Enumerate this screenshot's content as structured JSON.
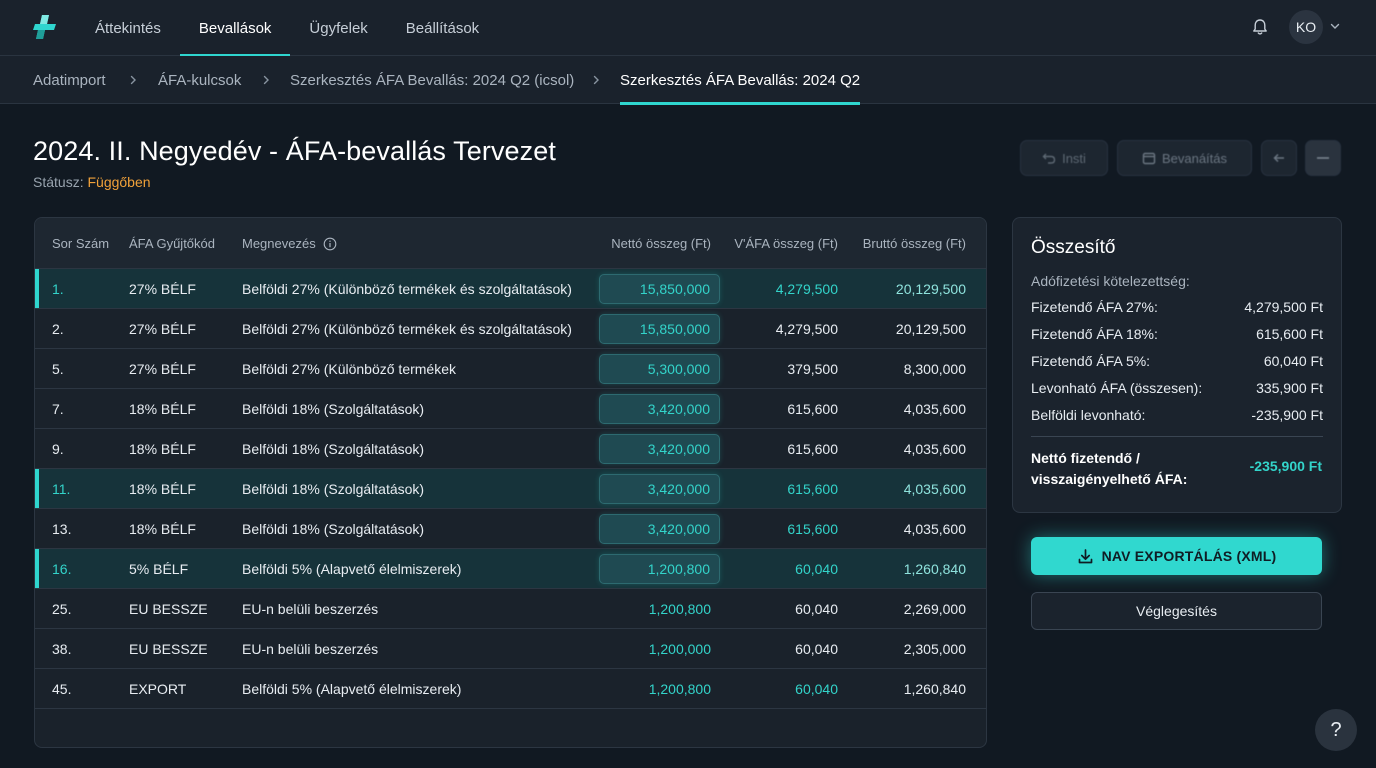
{
  "nav": {
    "items": [
      {
        "label": "Áttekintés"
      },
      {
        "label": "Bevallások"
      },
      {
        "label": "Ügyfelek"
      },
      {
        "label": "Beállítások"
      }
    ],
    "active": "Bevallások",
    "avatar_initials": "KO"
  },
  "breadcrumb": [
    {
      "label": "Adatimport"
    },
    {
      "label": "ÁFA-kulcsok"
    },
    {
      "label": "Szerkesztés ÁFA Bevallás: 2024 Q2 (icsol)"
    },
    {
      "label": "Szerkesztés ÁFA Bevallás: 2024 Q2"
    }
  ],
  "page": {
    "title": "2024. II. Negyedév - ÁFA-bevallás Tervezet",
    "status_label": "Státusz:",
    "status_value": "Függőben",
    "status_color": "#f0a13a"
  },
  "toolbar": {
    "undo_label": "Insti",
    "revert_label": "Bevanáítás"
  },
  "table": {
    "headers": {
      "row": "Sor Szám",
      "code": "ÁFA Gyűjtőkód",
      "name": "Megnevezés",
      "net": "Nettó összeg (Ft)",
      "vat": "V'ÁFA összeg (Ft)",
      "gross": "Bruttó összeg (Ft)"
    },
    "rows": [
      {
        "row": "1.",
        "code": "27% BÉLF",
        "name": "Belföldi 27% (Különböző termékek és szolgáltatások)",
        "net": "15,850,000",
        "vat": "4,279,500",
        "gross": "20,129,500"
      },
      {
        "row": "2.",
        "code": "27% BÉLF",
        "name": "Belföldi 27% (Különböző termékek és szolgáltatások)",
        "net": "15,850,000",
        "vat": "4,279,500",
        "gross": "20,129,500"
      },
      {
        "row": "5.",
        "code": "27% BÉLF",
        "name": "Belföldi 27% (Különböző termékek",
        "net": "5,300,000",
        "vat": "379,500",
        "gross": "8,300,000"
      },
      {
        "row": "7.",
        "code": "18% BÉLF",
        "name": "Belföldi 18% (Szolgáltatások)",
        "net": "3,420,000",
        "vat": "615,600",
        "gross": "4,035,600"
      },
      {
        "row": "9.",
        "code": "18% BÉLF",
        "name": "Belföldi 18% (Szolgáltatások)",
        "net": "3,420,000",
        "vat": "615,600",
        "gross": "4,035,600"
      },
      {
        "row": "11.",
        "code": "18% BÉLF",
        "name": "Belföldi 18% (Szolgáltatások)",
        "net": "3,420,000",
        "vat": "615,600",
        "gross": "4,035,600"
      },
      {
        "row": "13.",
        "code": "18% BÉLF",
        "name": "Belföldi 18% (Szolgáltatások)",
        "net": "3,420,000",
        "vat": "615,600",
        "gross": "4,035,600"
      },
      {
        "row": "16.",
        "code": "5% BÉLF",
        "name": "Belföldi 5% (Alapvető élelmiszerek)",
        "net": "1,200,800",
        "vat": "60,040",
        "gross": "1,260,840"
      },
      {
        "row": "25.",
        "code": "EU BESSZE",
        "name": "EU-n belüli beszerzés",
        "net": "1,200,800",
        "vat": "60,040",
        "gross": "2,269,000"
      },
      {
        "row": "38.",
        "code": "EU BESSZE",
        "name": "EU-n belüli beszerzés",
        "net": "1,200,000",
        "vat": "60,040",
        "gross": "2,305,000"
      },
      {
        "row": "45.",
        "code": "EXPORT",
        "name": "Belföldi 5% (Alapvető élelmiszerek)",
        "net": "1,200,800",
        "vat": "60,040",
        "gross": "1,260,840"
      }
    ]
  },
  "summary": {
    "title": "Összesítő",
    "subtitle": "Adófizetési kötelezettség:",
    "rows": [
      {
        "label": "Fizetendő ÁFA 27%:",
        "value": "4,279,500 Ft"
      },
      {
        "label": "Fizetendő ÁFA 18%:",
        "value": "615,600 Ft"
      },
      {
        "label": "Fizetendő ÁFA 5%:",
        "value": "60,040 Ft"
      },
      {
        "label": "Levonható ÁFA (összesen):",
        "value": "335,900 Ft"
      },
      {
        "label": "Belföldi levonható:",
        "value": "-235,900 Ft"
      }
    ],
    "net_label_line1": "Nettó fizetendő /",
    "net_label_line2": "visszaigényelhető ÁFA:",
    "net_value": "-235,900 Ft"
  },
  "actions": {
    "export_label": "NAV EXPORTÁLÁS (XML)",
    "finalize_label": "Véglegesítés",
    "help_label": "?"
  },
  "colors": {
    "accent": "#2fd6cf",
    "background": "#111922",
    "pending": "#f0a13a"
  }
}
